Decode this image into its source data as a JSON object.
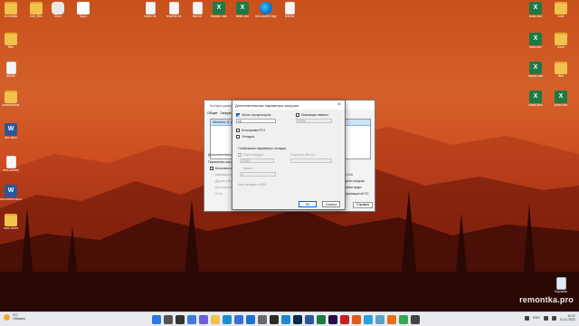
{
  "desktop": {
    "icons_top": [
      {
        "name": "folder",
        "label": "remontka"
      },
      {
        "name": "folder",
        "label": "hint_files"
      },
      {
        "name": "game",
        "label": "Xbox"
      },
      {
        "name": "dots",
        "label": "Apps"
      },
      {
        "name": "file",
        "label": "notes.txt"
      },
      {
        "name": "file",
        "label": "readme.txt"
      },
      {
        "name": "file",
        "label": "test.txt"
      },
      {
        "name": "excel",
        "label": "Книга1.xlsx"
      },
      {
        "name": "excel",
        "label": "table.xlsx"
      },
      {
        "name": "edge",
        "label": "Microsoft Edge"
      },
      {
        "name": "file",
        "label": "text.txt"
      }
    ],
    "icons_left": [
      {
        "name": "folder",
        "label": "files"
      },
      {
        "name": "file",
        "label": "list.txt"
      },
      {
        "name": "folder",
        "label": "screenshots"
      },
      {
        "name": "word",
        "label": "doc.docx"
      },
      {
        "name": "file",
        "label": "mac-screen"
      },
      {
        "name": "word",
        "label": "document.docx"
      },
      {
        "name": "folder",
        "label": "mac-cores"
      }
    ],
    "icons_right": [
      {
        "name": "excel",
        "label": "book.xlsx"
      },
      {
        "name": "folder",
        "label": "work"
      },
      {
        "name": "excel",
        "label": "data.xlsx"
      },
      {
        "name": "folder",
        "label": "docs"
      },
      {
        "name": "excel",
        "label": "report.xlsx"
      },
      {
        "name": "folder",
        "label": "files"
      },
      {
        "name": "excel",
        "label": "sheet.xlsx"
      },
      {
        "name": "excel",
        "label": "price.xlsx"
      }
    ],
    "recycle_bin": {
      "label": "Корзина"
    }
  },
  "syscfg_window": {
    "title": "Конфигурация системы",
    "tabs": [
      "Общие",
      "Загрузка"
    ],
    "boot_entry": "Windows 11 (C:\\Windows)",
    "advanced_label": "Дополнительные",
    "params_label": "Параметры загрузки",
    "safe_mode": "Безопасный режим",
    "opt_minimal": "Минимальная",
    "opt_shell": "Другая оболочка",
    "opt_restore": "Восстановление",
    "opt_network": "Сеть",
    "right_options": [
      "Без GUI",
      "Журнал загрузки",
      "Базовое видео",
      "Информация об ОС"
    ],
    "apply_label": "Справка"
  },
  "dialog": {
    "title": "Дополнительные параметры загрузки",
    "cpu_count_label": "Число процессоров:",
    "cpu_count_value": "16",
    "max_memory_label": "Максимум памяти:",
    "max_memory_value": "65536",
    "pci_lock_label": "Блокировка PCI",
    "debug_label": "Отладка",
    "global_debug_label": "Глобальные параметры отладки",
    "debug_port_label": "Порт отладки:",
    "debug_port_value": "COM1",
    "baud_label": "Скорость (бит/с):",
    "channel_label": "Канал:",
    "channel_value": "0",
    "usb_name_label": "Имя целевого USB:",
    "ok_label": "OK",
    "cancel_label": "Отмена"
  },
  "watermark": "remontka.pro",
  "taskbar": {
    "weather_temp": "9°C",
    "weather_desc": "Облачно",
    "lang": "ENG",
    "time": "10:47",
    "date": "10.11.2022",
    "pinned": [
      "start",
      "search",
      "task-view",
      "widgets",
      "chat",
      "explorer",
      "edge",
      "store",
      "mail",
      "settings",
      "terminal",
      "vscode",
      "photoshop",
      "word",
      "excel",
      "premiere",
      "acrobat",
      "player",
      "paint",
      "notepad",
      "firefox",
      "chrome",
      "calculator"
    ]
  },
  "colors": {
    "accent": "#0a64c8",
    "taskbar": "#e8eaf0",
    "wallpaper_top": "#c8501c"
  }
}
